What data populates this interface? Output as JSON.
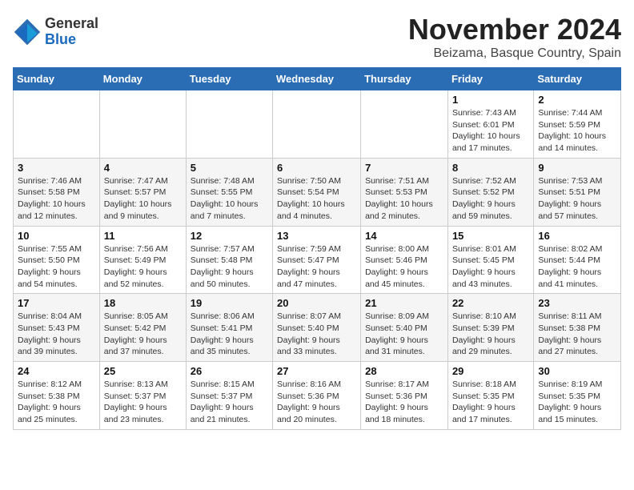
{
  "header": {
    "logo_general": "General",
    "logo_blue": "Blue",
    "month_title": "November 2024",
    "location": "Beizama, Basque Country, Spain"
  },
  "weekdays": [
    "Sunday",
    "Monday",
    "Tuesday",
    "Wednesday",
    "Thursday",
    "Friday",
    "Saturday"
  ],
  "weeks": [
    [
      {
        "day": "",
        "info": ""
      },
      {
        "day": "",
        "info": ""
      },
      {
        "day": "",
        "info": ""
      },
      {
        "day": "",
        "info": ""
      },
      {
        "day": "",
        "info": ""
      },
      {
        "day": "1",
        "info": "Sunrise: 7:43 AM\nSunset: 6:01 PM\nDaylight: 10 hours and 17 minutes."
      },
      {
        "day": "2",
        "info": "Sunrise: 7:44 AM\nSunset: 5:59 PM\nDaylight: 10 hours and 14 minutes."
      }
    ],
    [
      {
        "day": "3",
        "info": "Sunrise: 7:46 AM\nSunset: 5:58 PM\nDaylight: 10 hours and 12 minutes."
      },
      {
        "day": "4",
        "info": "Sunrise: 7:47 AM\nSunset: 5:57 PM\nDaylight: 10 hours and 9 minutes."
      },
      {
        "day": "5",
        "info": "Sunrise: 7:48 AM\nSunset: 5:55 PM\nDaylight: 10 hours and 7 minutes."
      },
      {
        "day": "6",
        "info": "Sunrise: 7:50 AM\nSunset: 5:54 PM\nDaylight: 10 hours and 4 minutes."
      },
      {
        "day": "7",
        "info": "Sunrise: 7:51 AM\nSunset: 5:53 PM\nDaylight: 10 hours and 2 minutes."
      },
      {
        "day": "8",
        "info": "Sunrise: 7:52 AM\nSunset: 5:52 PM\nDaylight: 9 hours and 59 minutes."
      },
      {
        "day": "9",
        "info": "Sunrise: 7:53 AM\nSunset: 5:51 PM\nDaylight: 9 hours and 57 minutes."
      }
    ],
    [
      {
        "day": "10",
        "info": "Sunrise: 7:55 AM\nSunset: 5:50 PM\nDaylight: 9 hours and 54 minutes."
      },
      {
        "day": "11",
        "info": "Sunrise: 7:56 AM\nSunset: 5:49 PM\nDaylight: 9 hours and 52 minutes."
      },
      {
        "day": "12",
        "info": "Sunrise: 7:57 AM\nSunset: 5:48 PM\nDaylight: 9 hours and 50 minutes."
      },
      {
        "day": "13",
        "info": "Sunrise: 7:59 AM\nSunset: 5:47 PM\nDaylight: 9 hours and 47 minutes."
      },
      {
        "day": "14",
        "info": "Sunrise: 8:00 AM\nSunset: 5:46 PM\nDaylight: 9 hours and 45 minutes."
      },
      {
        "day": "15",
        "info": "Sunrise: 8:01 AM\nSunset: 5:45 PM\nDaylight: 9 hours and 43 minutes."
      },
      {
        "day": "16",
        "info": "Sunrise: 8:02 AM\nSunset: 5:44 PM\nDaylight: 9 hours and 41 minutes."
      }
    ],
    [
      {
        "day": "17",
        "info": "Sunrise: 8:04 AM\nSunset: 5:43 PM\nDaylight: 9 hours and 39 minutes."
      },
      {
        "day": "18",
        "info": "Sunrise: 8:05 AM\nSunset: 5:42 PM\nDaylight: 9 hours and 37 minutes."
      },
      {
        "day": "19",
        "info": "Sunrise: 8:06 AM\nSunset: 5:41 PM\nDaylight: 9 hours and 35 minutes."
      },
      {
        "day": "20",
        "info": "Sunrise: 8:07 AM\nSunset: 5:40 PM\nDaylight: 9 hours and 33 minutes."
      },
      {
        "day": "21",
        "info": "Sunrise: 8:09 AM\nSunset: 5:40 PM\nDaylight: 9 hours and 31 minutes."
      },
      {
        "day": "22",
        "info": "Sunrise: 8:10 AM\nSunset: 5:39 PM\nDaylight: 9 hours and 29 minutes."
      },
      {
        "day": "23",
        "info": "Sunrise: 8:11 AM\nSunset: 5:38 PM\nDaylight: 9 hours and 27 minutes."
      }
    ],
    [
      {
        "day": "24",
        "info": "Sunrise: 8:12 AM\nSunset: 5:38 PM\nDaylight: 9 hours and 25 minutes."
      },
      {
        "day": "25",
        "info": "Sunrise: 8:13 AM\nSunset: 5:37 PM\nDaylight: 9 hours and 23 minutes."
      },
      {
        "day": "26",
        "info": "Sunrise: 8:15 AM\nSunset: 5:37 PM\nDaylight: 9 hours and 21 minutes."
      },
      {
        "day": "27",
        "info": "Sunrise: 8:16 AM\nSunset: 5:36 PM\nDaylight: 9 hours and 20 minutes."
      },
      {
        "day": "28",
        "info": "Sunrise: 8:17 AM\nSunset: 5:36 PM\nDaylight: 9 hours and 18 minutes."
      },
      {
        "day": "29",
        "info": "Sunrise: 8:18 AM\nSunset: 5:35 PM\nDaylight: 9 hours and 17 minutes."
      },
      {
        "day": "30",
        "info": "Sunrise: 8:19 AM\nSunset: 5:35 PM\nDaylight: 9 hours and 15 minutes."
      }
    ]
  ]
}
